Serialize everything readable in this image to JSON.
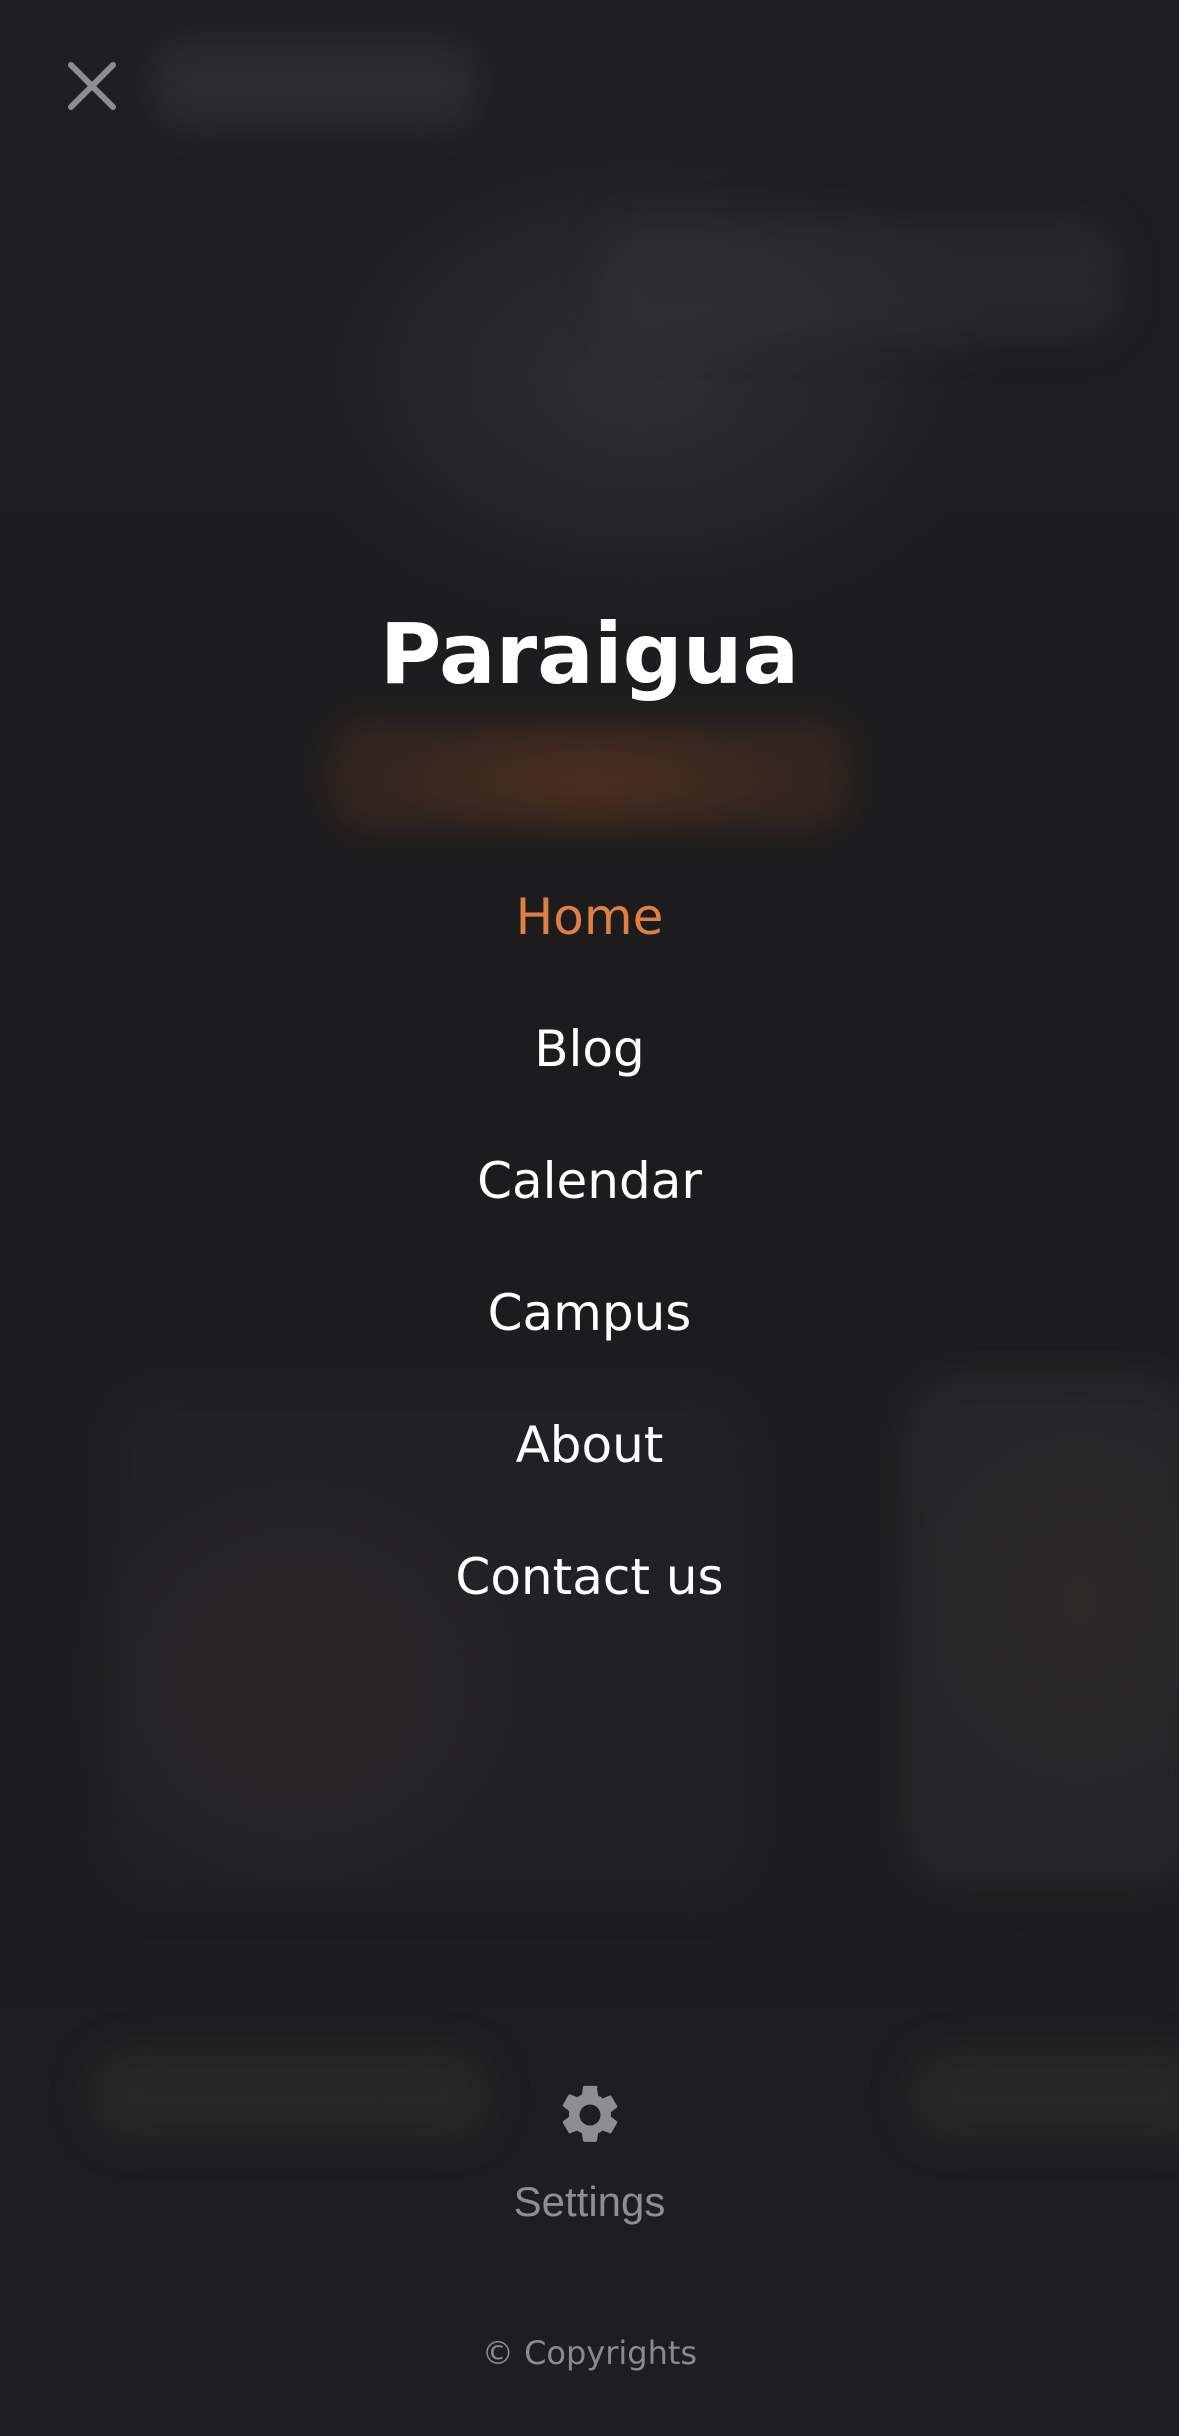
{
  "brand": {
    "title": "Paraigua"
  },
  "close": {
    "icon": "close-icon",
    "color": "#8e8e92"
  },
  "menu": {
    "items": [
      {
        "label": "Home",
        "active": true
      },
      {
        "label": "Blog",
        "active": false
      },
      {
        "label": "Calendar",
        "active": false
      },
      {
        "label": "Campus",
        "active": false
      },
      {
        "label": "About",
        "active": false
      },
      {
        "label": "Contact us",
        "active": false
      }
    ],
    "active_color": "#e07f42",
    "text_color": "#ffffff"
  },
  "settings": {
    "icon": "gear-icon",
    "label": "Settings"
  },
  "footer": {
    "copyright": "© Copyrights"
  },
  "theme": {
    "background": "#1e1e20",
    "muted": "#8e8e92"
  }
}
